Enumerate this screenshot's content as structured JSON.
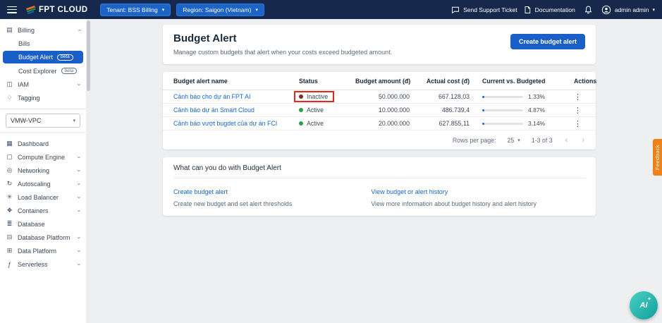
{
  "header": {
    "logo_text": "FPT CLOUD",
    "tenant": "Tenant: BSS Billing",
    "region": "Region: Saigon (Vietnam)",
    "support": "Send Support Ticket",
    "docs": "Documentation",
    "user": "admin admin"
  },
  "sidebar": {
    "top_items": [
      {
        "label": "Billing"
      },
      {
        "label": "Bills"
      },
      {
        "label": "Budget Alert",
        "badge": "beta"
      },
      {
        "label": "Cost Explorer",
        "badge": "beta"
      },
      {
        "label": "IAM"
      },
      {
        "label": "Tagging"
      }
    ],
    "vpc_select": "VMW-VPC",
    "menu_items": [
      {
        "label": "Dashboard"
      },
      {
        "label": "Compute Engine"
      },
      {
        "label": "Networking"
      },
      {
        "label": "Autoscaling"
      },
      {
        "label": "Load Balancer"
      },
      {
        "label": "Containers"
      },
      {
        "label": "Database"
      },
      {
        "label": "Database Platform"
      },
      {
        "label": "Data Platform"
      },
      {
        "label": "Serverless"
      }
    ]
  },
  "main": {
    "title": "Budget Alert",
    "subtitle": "Manage custom budgets that alert when your costs exceed budgeted amount.",
    "create_button": "Create budget alert",
    "table": {
      "columns": [
        "Budget alert name",
        "Status",
        "Budget amount (đ)",
        "Actual cost (đ)",
        "Current vs. Budgeted",
        "Actions"
      ],
      "rows": [
        {
          "name": "Cảnh báo cho dự án FPT AI",
          "status": "Inactive",
          "status_color": "#7e2b25",
          "budget": "50.000.000",
          "actual": "667.128,03",
          "percent": "1.33%"
        },
        {
          "name": "Cảnh báo dự án Smart Cloud",
          "status": "Active",
          "status_color": "#2e9e44",
          "budget": "10.000.000",
          "actual": "486.739,4",
          "percent": "4.87%"
        },
        {
          "name": "Cảnh báo vượt bugdet của dự án FCI",
          "status": "Active",
          "status_color": "#2e9e44",
          "budget": "20.000.000",
          "actual": "627.855,11",
          "percent": "3.14%"
        }
      ],
      "pagination": {
        "rows_per_page_label": "Rows per page:",
        "rows_per_page": "25",
        "range": "1-3 of 3"
      }
    },
    "help": {
      "title": "What can you do with Budget Alert",
      "links": [
        {
          "label": "Create budget alert",
          "desc": "Create new budget and set alert thresholds"
        },
        {
          "label": "View budget or alert history",
          "desc": "View more information about budget history and alert history"
        }
      ]
    }
  },
  "feedback_tab": "Feedback",
  "ai_button_label": "AI",
  "colors": {
    "accent": "#1a5fc8",
    "active_status": "#2e9e44",
    "inactive_status": "#7e2b25",
    "annotation_red": "#e0281c",
    "feedback_orange": "#f08119"
  }
}
